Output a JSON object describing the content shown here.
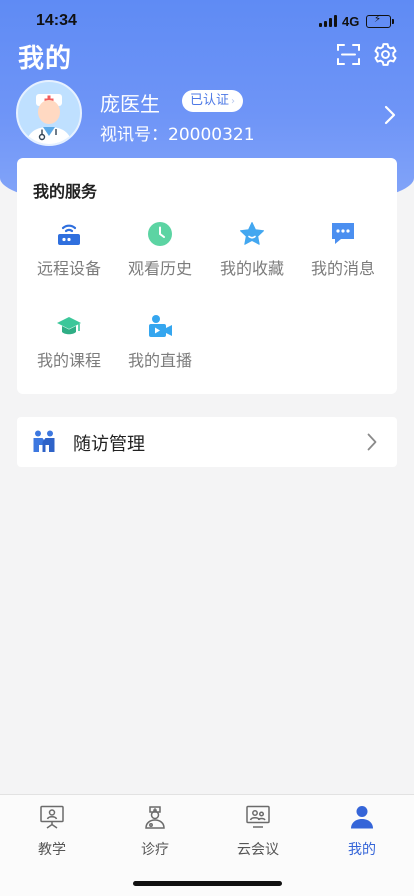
{
  "status_bar": {
    "time": "14:34",
    "network": "4G",
    "battery_level": 0.7
  },
  "header": {
    "title": "我的"
  },
  "profile": {
    "name": "庞医生",
    "badge": "已认证",
    "id_text": "视讯号：20000321"
  },
  "services": {
    "title": "我的服务",
    "items": [
      {
        "label": "远程设备",
        "icon": "router-icon"
      },
      {
        "label": "观看历史",
        "icon": "clock-icon"
      },
      {
        "label": "我的收藏",
        "icon": "star-icon"
      },
      {
        "label": "我的消息",
        "icon": "message-icon"
      },
      {
        "label": "我的课程",
        "icon": "graduation-cap-icon"
      },
      {
        "label": "我的直播",
        "icon": "live-camera-icon"
      }
    ]
  },
  "followup": {
    "label": "随访管理",
    "icon": "people-icon"
  },
  "tabbar": {
    "items": [
      {
        "label": "教学",
        "icon": "presentation-icon"
      },
      {
        "label": "诊疗",
        "icon": "doctor-icon"
      },
      {
        "label": "云会议",
        "icon": "meeting-icon"
      },
      {
        "label": "我的",
        "icon": "user-icon"
      }
    ],
    "active_index": 3
  },
  "colors": {
    "accent": "#3565d8",
    "header_gradient_top": "#5f8bf4",
    "header_gradient_bottom": "#86a7f9",
    "page_bg": "#f4f4f5"
  }
}
